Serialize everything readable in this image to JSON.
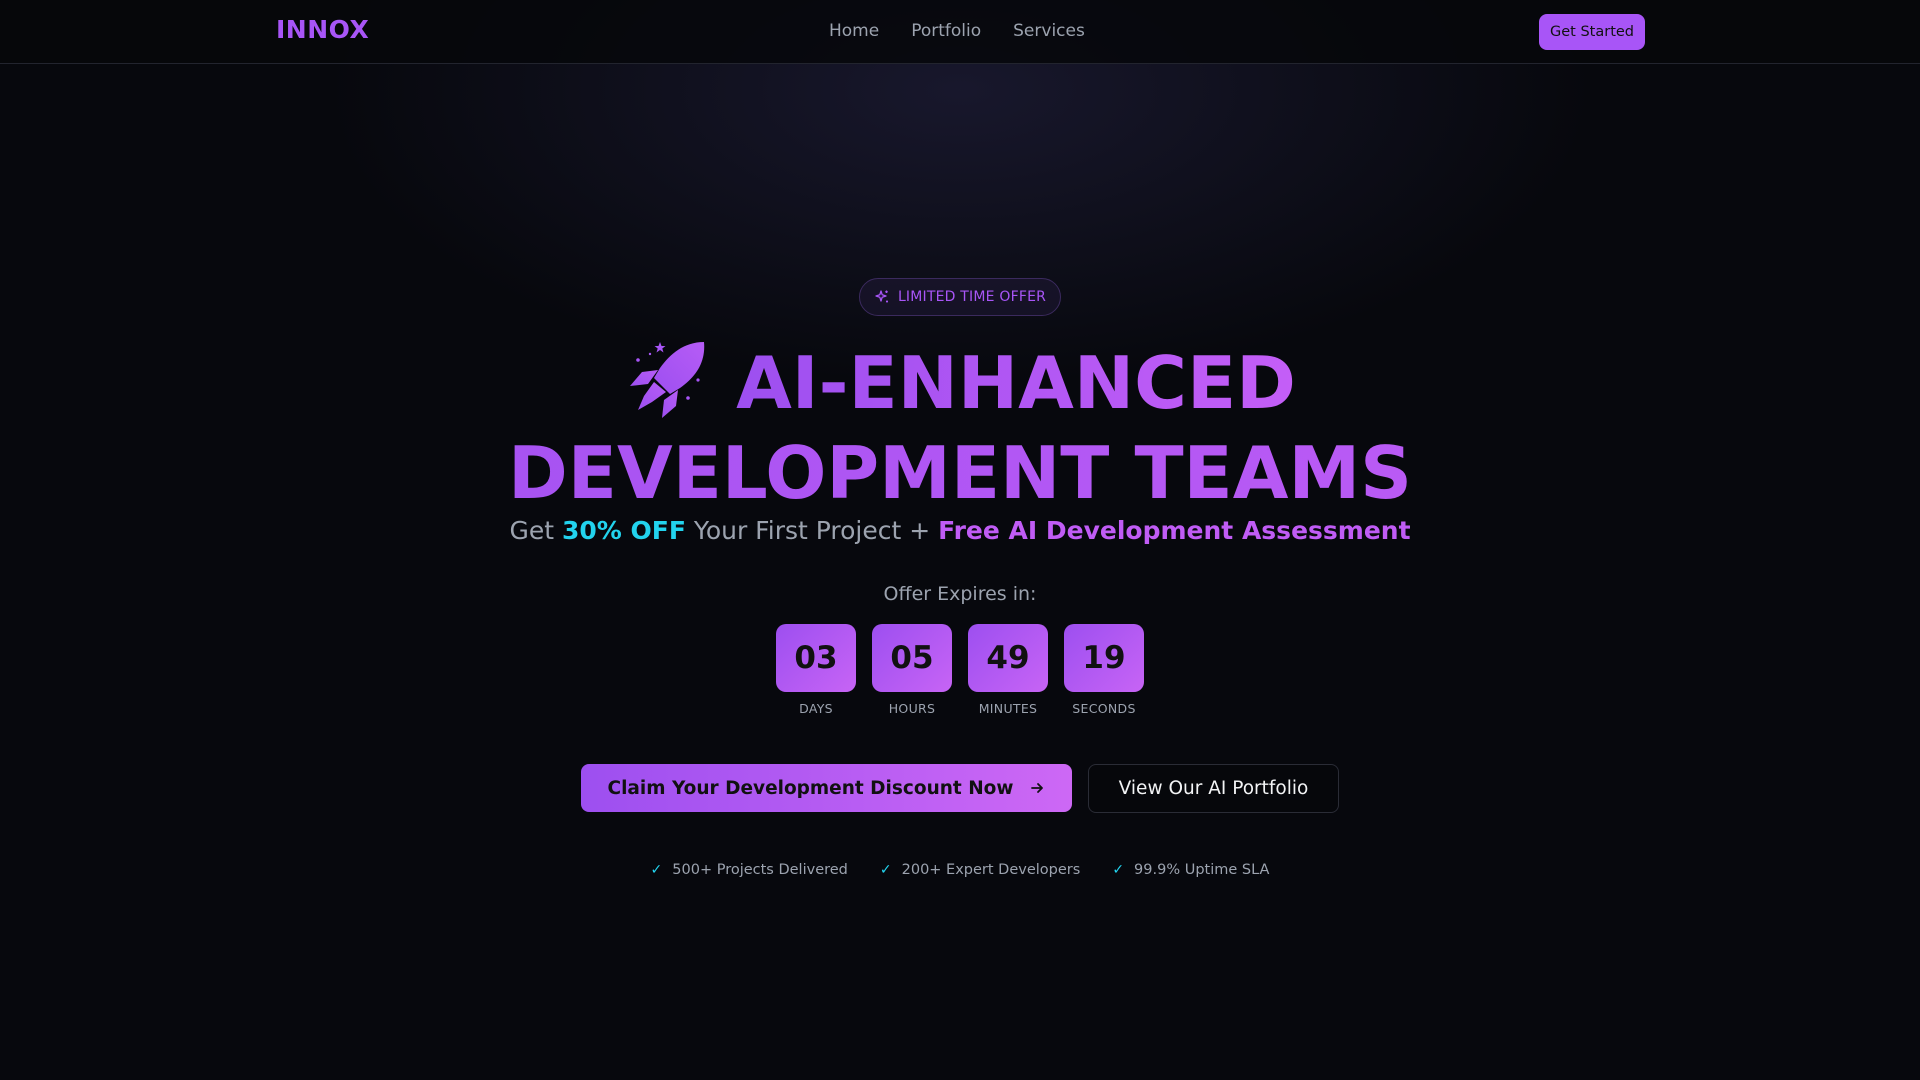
{
  "nav": {
    "logo": "INNOX",
    "links": [
      "Home",
      "Portfolio",
      "Services"
    ],
    "cta": "Get Started"
  },
  "hero": {
    "badge": {
      "icon": "sparkle-icon",
      "text": "LIMITED TIME OFFER"
    },
    "headline": {
      "icon": "rocket-icon",
      "line1": "AI-ENHANCED",
      "line2": "DEVELOPMENT TEAMS"
    },
    "subhead": {
      "prefix": "Get ",
      "discount": "30% OFF",
      "middle": " Your First Project + ",
      "bonus": "Free AI Development Assessment"
    },
    "expires_label": "Offer Expires in:",
    "countdown": [
      {
        "value": "03",
        "label": "DAYS"
      },
      {
        "value": "05",
        "label": "HOURS"
      },
      {
        "value": "49",
        "label": "MINUTES"
      },
      {
        "value": "19",
        "label": "SECONDS"
      }
    ],
    "cta_primary": "Claim Your Development Discount Now",
    "cta_primary_icon": "arrow-right-icon",
    "cta_secondary": "View Our AI Portfolio",
    "stats": [
      {
        "icon": "check-icon",
        "text": "500+ Projects Delivered"
      },
      {
        "icon": "check-icon",
        "text": "200+ Expert Developers"
      },
      {
        "icon": "check-icon",
        "text": "99.9% Uptime SLA"
      }
    ]
  },
  "colors": {
    "accent": "#a855f7",
    "accent_light": "#c45ef7",
    "cyan": "#22d3ee",
    "text_muted": "#9ca3af",
    "background": "#07080d"
  }
}
